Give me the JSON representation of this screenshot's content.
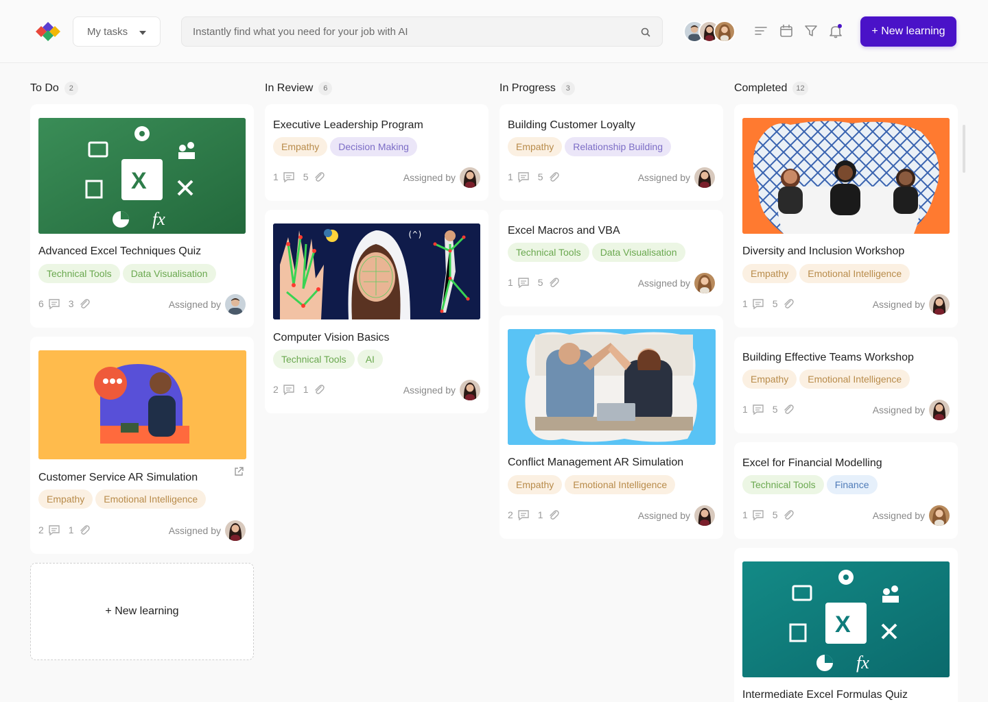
{
  "header": {
    "my_tasks_label": "My tasks",
    "search_placeholder": "Instantly find what you need for your job with AI",
    "new_learning_label": "+ New learning",
    "accent_color": "#4a12c8"
  },
  "columns": [
    {
      "title": "To Do",
      "count": "2",
      "cards": [
        {
          "title": "Advanced Excel Techniques Quiz",
          "tags": [
            "Technical Tools",
            "Data Visualisation"
          ],
          "comments": "6",
          "attachments": "3",
          "assigned_label": "Assigned by"
        },
        {
          "title": "Customer Service AR Simulation",
          "tags": [
            "Empathy",
            "Emotional Intelligence"
          ],
          "comments": "2",
          "attachments": "1",
          "assigned_label": "Assigned by"
        }
      ],
      "new_learning_label": "+ New learning"
    },
    {
      "title": "In Review",
      "count": "6",
      "cards": [
        {
          "title": "Executive Leadership Program",
          "tags": [
            "Empathy",
            "Decision Making"
          ],
          "comments": "1",
          "attachments": "5",
          "assigned_label": "Assigned by"
        },
        {
          "title": "Computer Vision Basics",
          "tags": [
            "Technical Tools",
            "AI"
          ],
          "comments": "2",
          "attachments": "1",
          "assigned_label": "Assigned by"
        }
      ]
    },
    {
      "title": "In Progress",
      "count": "3",
      "cards": [
        {
          "title": "Building Customer Loyalty",
          "tags": [
            "Empathy",
            "Relationship Building"
          ],
          "comments": "1",
          "attachments": "5",
          "assigned_label": "Assigned by"
        },
        {
          "title": "Excel Macros and VBA",
          "tags": [
            "Technical Tools",
            "Data Visualisation"
          ],
          "comments": "1",
          "attachments": "5",
          "assigned_label": "Assigned by"
        },
        {
          "title": "Conflict Management AR Simulation",
          "tags": [
            "Empathy",
            "Emotional Intelligence"
          ],
          "comments": "2",
          "attachments": "1",
          "assigned_label": "Assigned by"
        }
      ]
    },
    {
      "title": "Completed",
      "count": "12",
      "cards": [
        {
          "title": "Diversity and Inclusion Workshop",
          "tags": [
            "Empathy",
            "Emotional Intelligence"
          ],
          "comments": "1",
          "attachments": "5",
          "assigned_label": "Assigned by"
        },
        {
          "title": "Building Effective Teams Workshop",
          "tags": [
            "Empathy",
            "Emotional Intelligence"
          ],
          "comments": "1",
          "attachments": "5",
          "assigned_label": "Assigned by"
        },
        {
          "title": "Excel for Financial Modelling",
          "tags": [
            "Technical Tools",
            "Finance"
          ],
          "comments": "1",
          "attachments": "5",
          "assigned_label": "Assigned by"
        },
        {
          "title": "Intermediate Excel Formulas Quiz"
        }
      ]
    }
  ]
}
